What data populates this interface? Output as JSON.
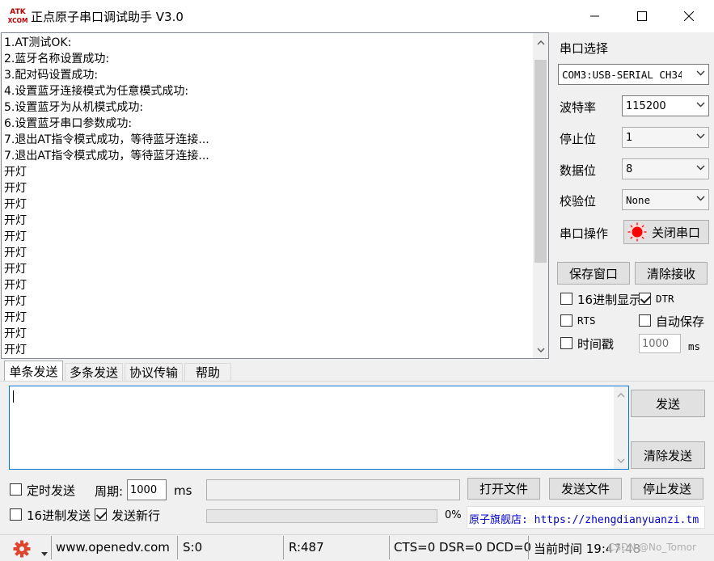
{
  "window": {
    "title": "正点原子串口调试助手 V3.0",
    "logo_text_top": "ATK",
    "logo_text_bottom": "XCOM"
  },
  "receive": {
    "lines": [
      "1.AT测试OK:",
      "2.蓝牙名称设置成功:",
      "3.配对码设置成功:",
      "4.设置蓝牙连接模式为任意模式成功:",
      "5.设置蓝牙为从机模式成功:",
      "6.设置蓝牙串口参数成功:",
      "7.退出AT指令模式成功，等待蓝牙连接...",
      "7.退出AT指令模式成功，等待蓝牙连接...",
      "开灯",
      "开灯",
      "开灯",
      "开灯",
      "开灯",
      "开灯",
      "开灯",
      "开灯",
      "开灯",
      "开灯",
      "开灯",
      "开灯"
    ]
  },
  "serial": {
    "port_select_label": "串口选择",
    "port_value": "COM3:USB-SERIAL CH340",
    "baud_label": "波特率",
    "baud_value": "115200",
    "stop_label": "停止位",
    "stop_value": "1",
    "data_label": "数据位",
    "data_value": "8",
    "parity_label": "校验位",
    "parity_value": "None",
    "op_label": "串口操作",
    "close_button": "关闭串口",
    "status_color": "#ff0000"
  },
  "actions": {
    "save_window": "保存窗口",
    "clear_receive": "清除接收",
    "hex_display": "16进制显示",
    "hex_display_checked": false,
    "dtr": "DTR",
    "dtr_checked": true,
    "rts": "RTS",
    "rts_checked": false,
    "auto_save": "自动保存",
    "auto_save_checked": false,
    "timestamp": "时间戳",
    "timestamp_checked": false,
    "timestamp_ms_value": "1000",
    "ms_unit": "ms"
  },
  "tabs": [
    {
      "label": "单条发送",
      "active": true
    },
    {
      "label": "多条发送",
      "active": false
    },
    {
      "label": "协议传输",
      "active": false
    },
    {
      "label": "帮助",
      "active": false
    }
  ],
  "send": {
    "input_value": "",
    "send_button": "发送",
    "clear_send_button": "清除发送",
    "timed_send": "定时发送",
    "timed_send_checked": false,
    "period_label": "周期:",
    "period_value": "1000",
    "period_unit": "ms",
    "open_file": "打开文件",
    "send_file": "发送文件",
    "stop_send": "停止发送",
    "hex_send": "16进制发送",
    "hex_send_checked": false,
    "send_newline": "发送新行",
    "send_newline_checked": true,
    "progress_percent": "0%",
    "progress_fraction": 0,
    "ad_text": "原子旗舰店: https://zhengdianyuanzi.tm",
    "ad_color": "#0000cc"
  },
  "status": {
    "website": "www.openedv.com",
    "sent": "S:0",
    "received": "R:487",
    "lines": "CTS=0 DSR=0 DCD=0",
    "time_label": "当前时间 19:47:48",
    "watermark": "CSDN @No_Tomor"
  },
  "colors": {
    "accent": "#0078d7",
    "gear": "#e0442c"
  }
}
